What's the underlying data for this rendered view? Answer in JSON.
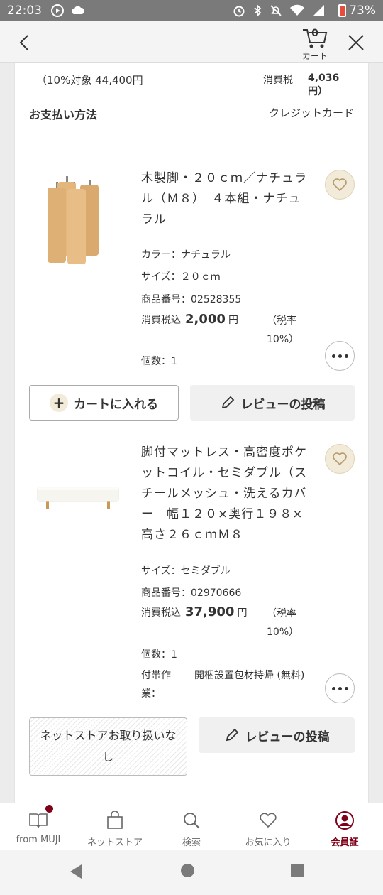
{
  "status_bar": {
    "time": "22:03",
    "battery_percent": "73%"
  },
  "header": {
    "cart_count": "0",
    "cart_label": "カート"
  },
  "order_summary": {
    "tax_target": "（10%対象 44,400円",
    "tax_label": "消費税",
    "tax_amount": "4,036 円）",
    "payment_label": "お支払い方法",
    "payment_value": "クレジットカード"
  },
  "products": [
    {
      "title": "木製脚・２０ｃｍ／ナチュラル（Ｍ８）　４本組・ナチュラル",
      "color": "カラー：ナチュラル",
      "size": "サイズ：２０ｃｍ",
      "item_number": "商品番号：02528355",
      "price_prefix": "消費税込",
      "price": "2,000",
      "price_unit": "円",
      "tax_rate": "（税率10%）",
      "quantity": "個数：1",
      "cart_button": "カートに入れる",
      "review_button": "レビューの投稿"
    },
    {
      "title": "脚付マットレス・高密度ポケットコイル・セミダブル（スチールメッシュ・洗えるカバー　幅１２０×奥行１９８×高さ２６ｃｍＭ８",
      "size": "サイズ：セミダブル",
      "item_number": "商品番号：02970666",
      "price_prefix": "消費税込",
      "price": "37,900",
      "price_unit": "円",
      "tax_rate": "（税率10%）",
      "quantity": "個数：1",
      "option_label": "付帯作業：",
      "option_value": "開梱設置包材持帰 (無料)",
      "unavailable_label": "ネットストアお取り扱いなし",
      "review_button": "レビューの投稿"
    }
  ],
  "bottom_nav": [
    {
      "label": "from MUJI",
      "icon": "book-icon"
    },
    {
      "label": "ネットストア",
      "icon": "shopping-bag-icon"
    },
    {
      "label": "検索",
      "icon": "search-icon"
    },
    {
      "label": "お気に入り",
      "icon": "heart-icon"
    },
    {
      "label": "会員証",
      "icon": "member-card-icon",
      "active": true
    }
  ],
  "colors": {
    "accent": "#7f0019",
    "fav_bg": "#f3ebd9"
  }
}
